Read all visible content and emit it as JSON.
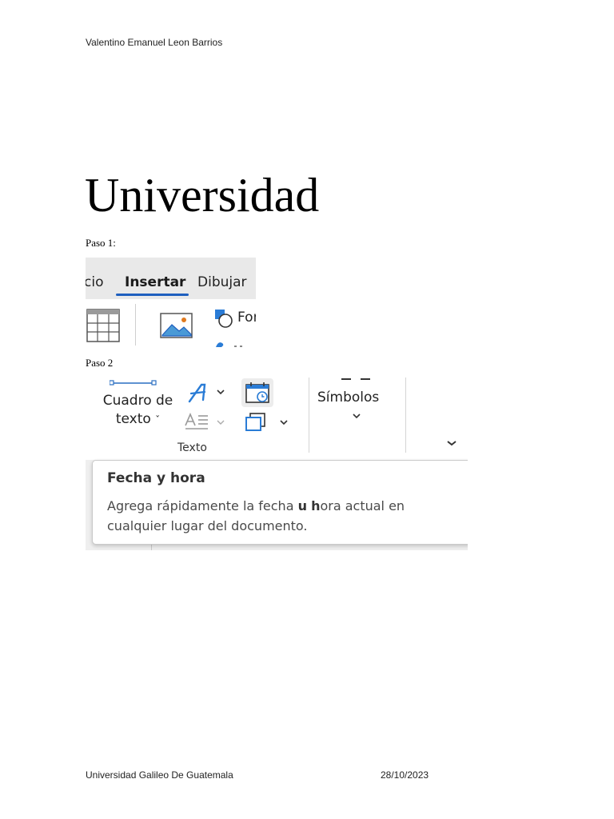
{
  "header": {
    "author": "Valentino Emanuel Leon Barrios"
  },
  "title": "Universidad",
  "steps": [
    {
      "label": "Paso 1:"
    },
    {
      "label": "Paso 2"
    }
  ],
  "screenshot1": {
    "tabs": [
      "cio",
      "Insertar",
      "Dibujar"
    ],
    "active_tab": "Insertar",
    "accent_color": "#1f5fbf",
    "icons": [
      "table-icon",
      "picture-icon",
      "shapes-icon",
      "icons-icon"
    ],
    "shapes_label": "For"
  },
  "screenshot2": {
    "text_box_label_line1": "Cuadro de",
    "text_box_label_line2": "texto",
    "text_group_label": "Texto",
    "symbols_label": "Símbolos",
    "icons": [
      "text-box-icon",
      "wordart-icon",
      "drop-cap-icon",
      "date-time-icon",
      "object-icon",
      "symbols-icon",
      "expand-ribbon-icon"
    ],
    "tooltip": {
      "title": "Fecha y hora",
      "description_part1": "Agrega rápidamente la fecha ",
      "description_bold1": "u",
      "description_part2": " ",
      "description_bold2": "h",
      "description_part3": "ora actual en cualquier lugar del documento."
    }
  },
  "footer": {
    "left": "Universidad Galileo De Guatemala",
    "right": "28/10/2023"
  }
}
